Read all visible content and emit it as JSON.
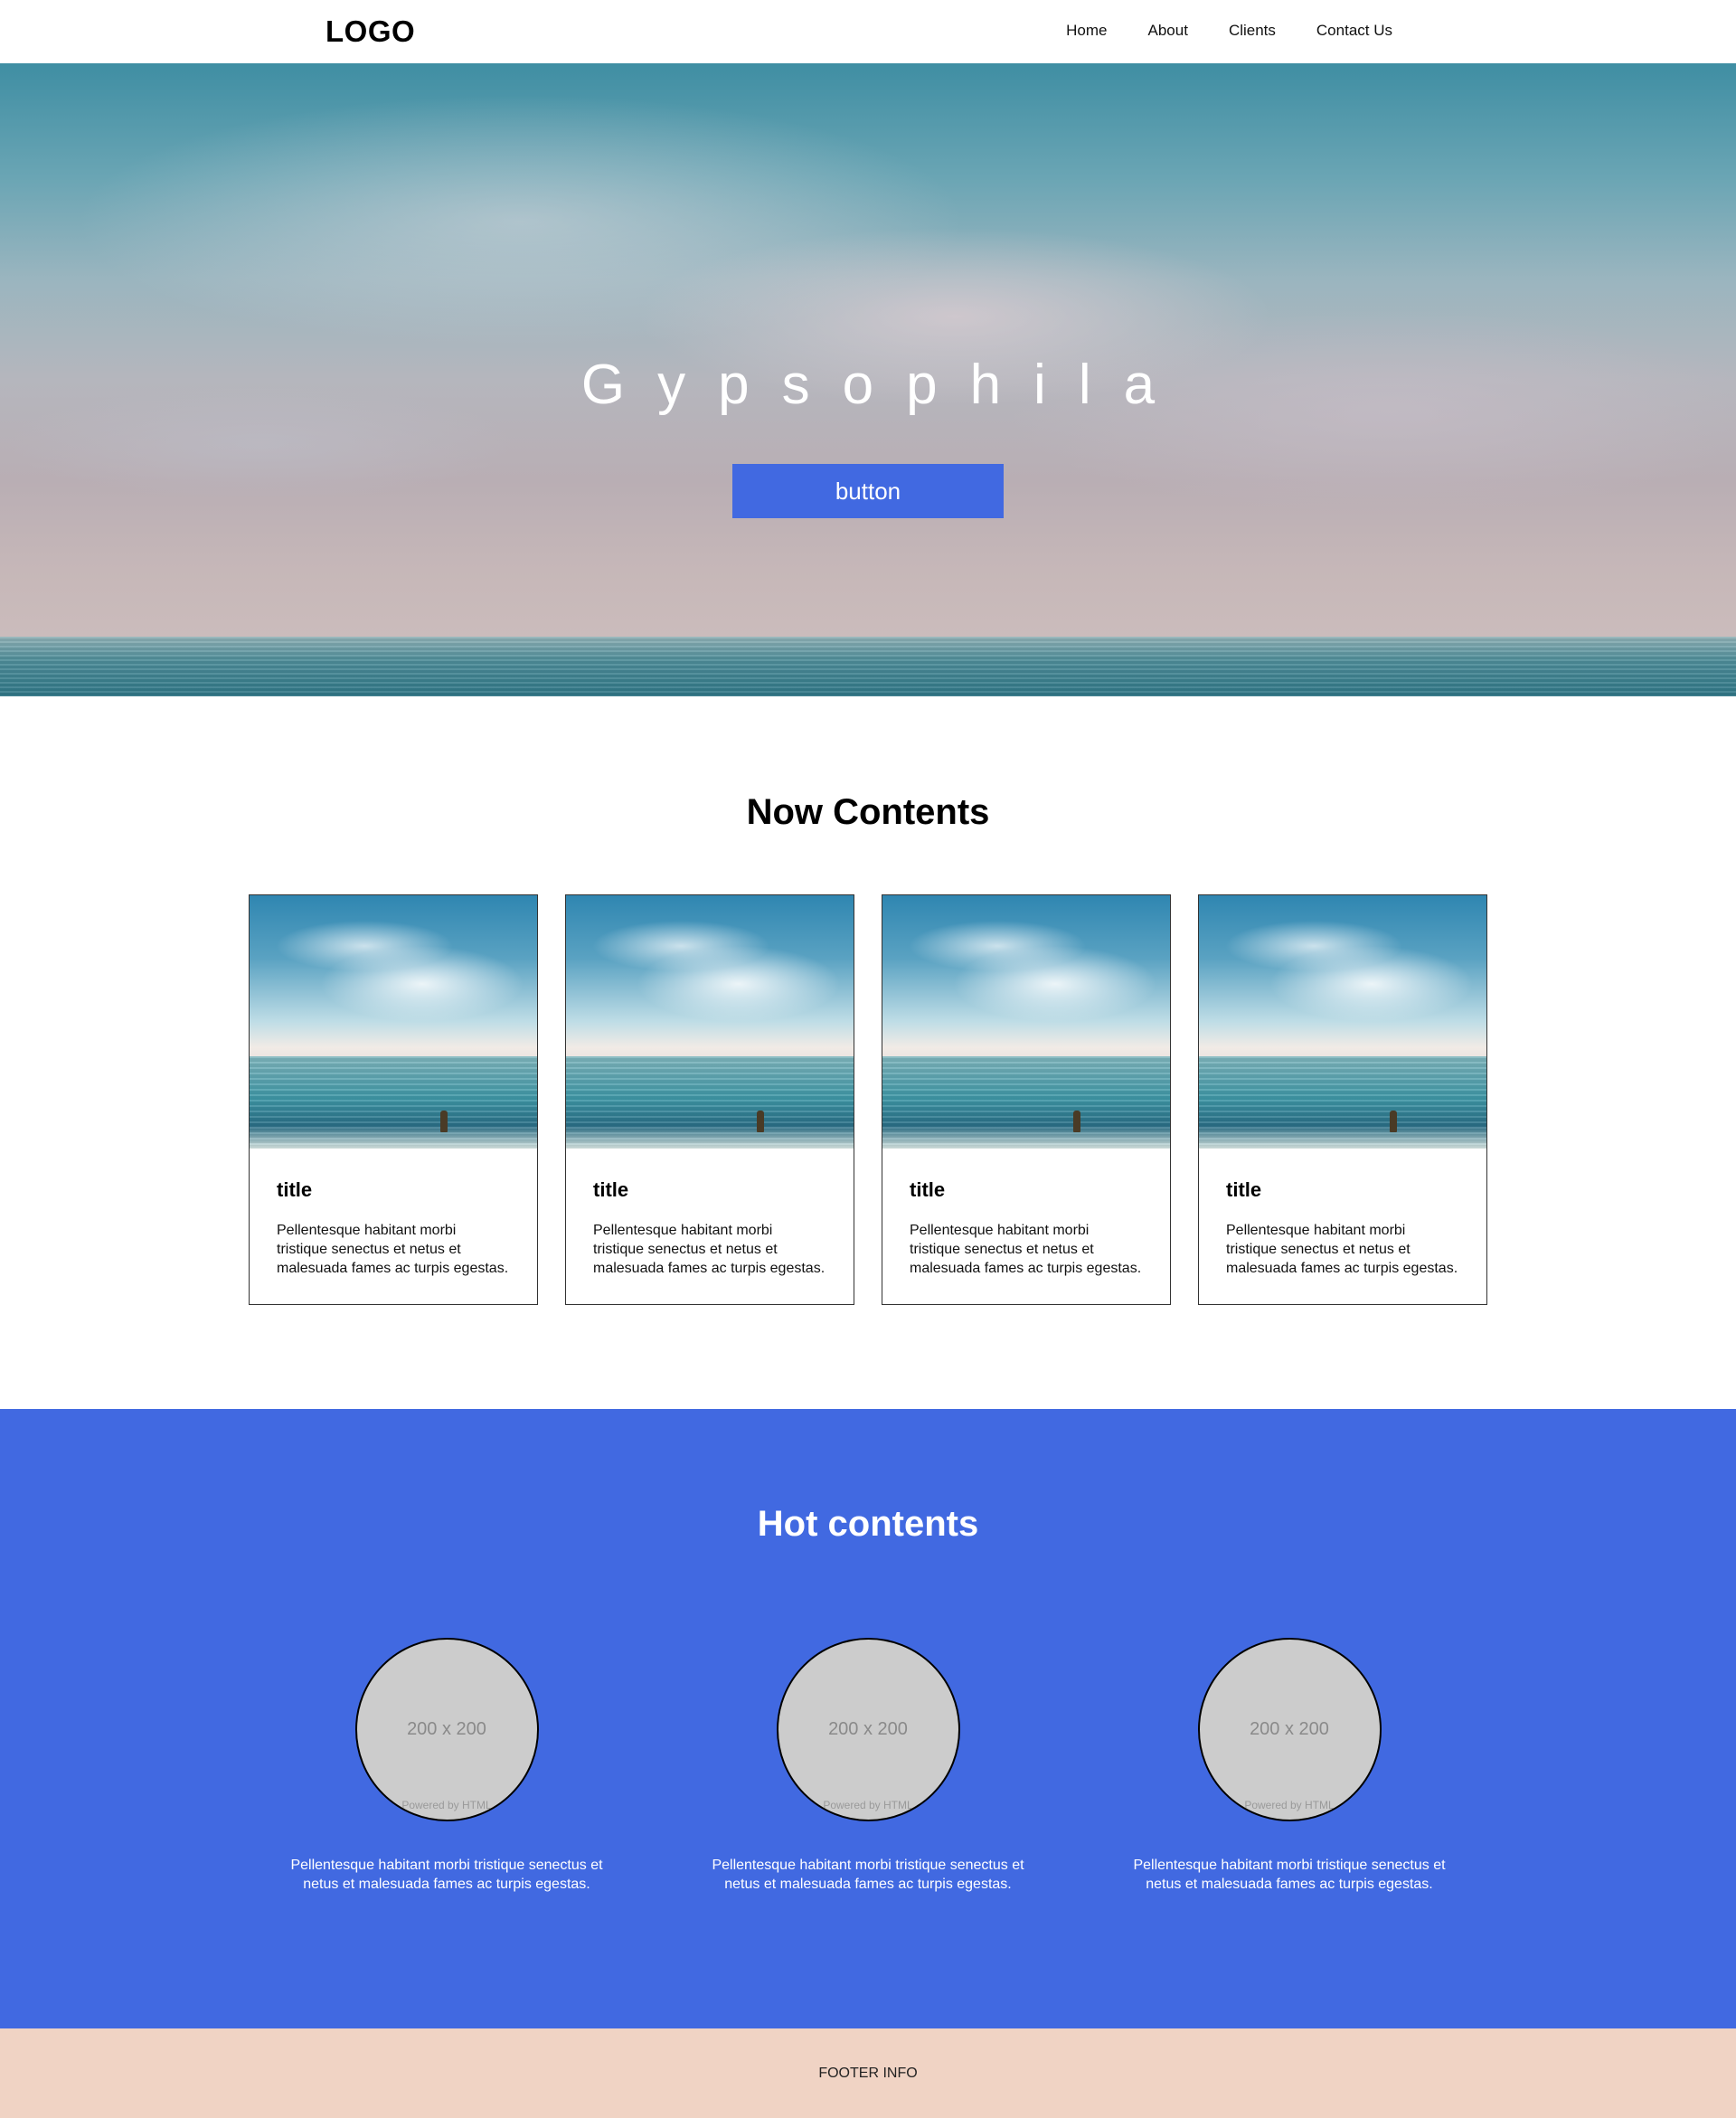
{
  "header": {
    "logo": "LOGO",
    "nav": [
      "Home",
      "About",
      "Clients",
      "Contact Us"
    ]
  },
  "hero": {
    "title": "Gypsophila",
    "button_label": "button"
  },
  "now_contents": {
    "heading": "Now Contents",
    "cards": [
      {
        "title": "title",
        "text": "Pellentesque habitant morbi tristique senectus et netus et malesuada fames ac turpis egestas."
      },
      {
        "title": "title",
        "text": "Pellentesque habitant morbi tristique senectus et netus et malesuada fames ac turpis egestas."
      },
      {
        "title": "title",
        "text": "Pellentesque habitant morbi tristique senectus et netus et malesuada fames ac turpis egestas."
      },
      {
        "title": "title",
        "text": "Pellentesque habitant morbi tristique senectus et netus et malesuada fames ac turpis egestas."
      }
    ]
  },
  "hot_contents": {
    "heading": "Hot contents",
    "items": [
      {
        "image_label": "200 x 200",
        "image_caption": "Powered by HTML",
        "text": "Pellentesque habitant morbi tristique senectus et netus et malesuada fames ac turpis egestas."
      },
      {
        "image_label": "200 x 200",
        "image_caption": "Powered by HTML",
        "text": "Pellentesque habitant morbi tristique senectus et netus et malesuada fames ac turpis egestas."
      },
      {
        "image_label": "200 x 200",
        "image_caption": "Powered by HTML",
        "text": "Pellentesque habitant morbi tristique senectus et netus et malesuada fames ac turpis egestas."
      }
    ]
  },
  "footer": {
    "text": "FOOTER INFO"
  },
  "colors": {
    "accent": "#4169e1",
    "footer_bg": "#f0d3c4"
  }
}
